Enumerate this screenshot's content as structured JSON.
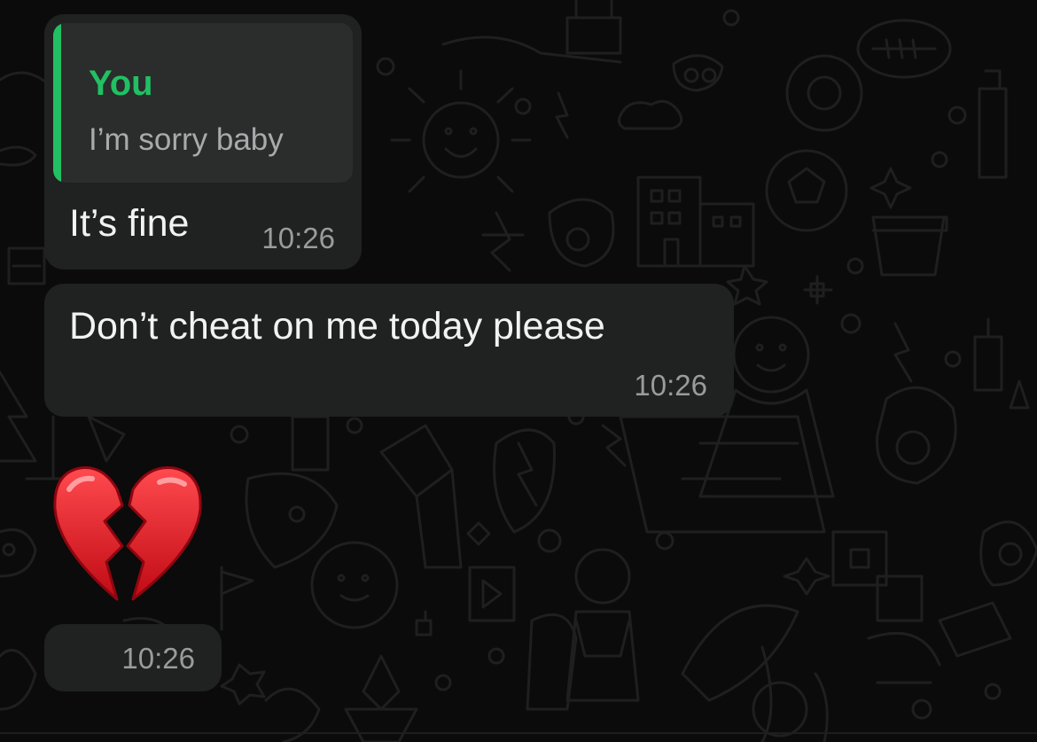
{
  "messages": [
    {
      "reply": {
        "sender": "You",
        "text": "I’m sorry baby"
      },
      "text": "It’s fine",
      "time": "10:26"
    },
    {
      "text": "Don’t cheat on me today please",
      "time": "10:26"
    },
    {
      "emoji": "broken-heart",
      "time": "10:26"
    }
  ],
  "colors": {
    "background": "#0b0b0b",
    "bubble": "#202121",
    "quote_background": "#2b2c2c",
    "accent": "#21c063",
    "text": "#f2f2f2",
    "muted": "#9a9b9c",
    "emoji_red": "#e8131c"
  }
}
